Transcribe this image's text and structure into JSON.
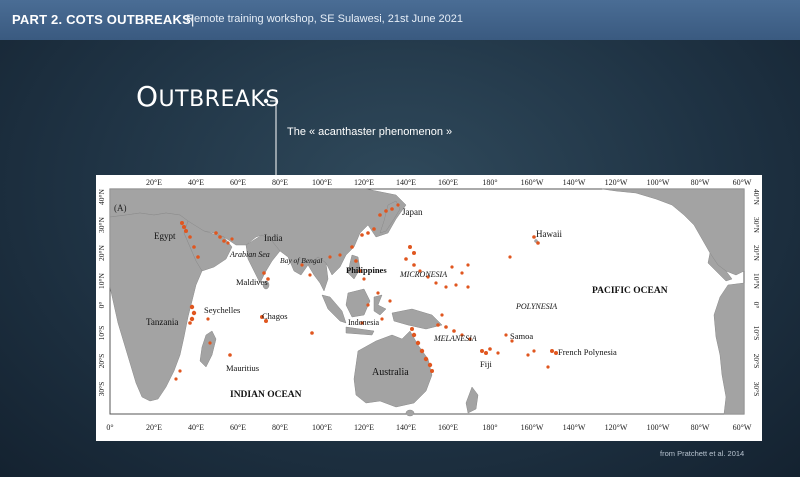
{
  "header": {
    "part_label": "PART 2. COTS OUTBREAKS",
    "separator": "|",
    "subtitle": "Remote training workshop, SE Sulawesi, 21st June 2021"
  },
  "slide": {
    "title_first_letter": "O",
    "title_rest": "UTBREAKS",
    "subtitle": "The « acanthaster phenomenon »",
    "credit": "from Pratchett et al. 2014"
  },
  "map": {
    "panel_label": "(A)",
    "top_longitude_labels": [
      "20°E",
      "40°E",
      "60°E",
      "80°E",
      "100°E",
      "120°E",
      "140°E",
      "160°E",
      "180°",
      "160°W",
      "140°W",
      "120°W",
      "100°W",
      "80°W",
      "60°W"
    ],
    "bottom_longitude_labels": [
      "0°",
      "20°E",
      "40°E",
      "60°E",
      "80°E",
      "100°E",
      "120°E",
      "140°E",
      "160°E",
      "180°",
      "160°W",
      "140°W",
      "120°W",
      "100°W",
      "80°W",
      "60°W"
    ],
    "left_latitude_labels": [
      "40°N",
      "30°N",
      "20°N",
      "10°N",
      "0°",
      "10°S",
      "20°S",
      "30°S"
    ],
    "right_latitude_labels": [
      "40°N",
      "30°N",
      "20°N",
      "10°N",
      "0°",
      "10°S",
      "20°S",
      "30°S"
    ],
    "place_labels": {
      "egypt": "Egypt",
      "india": "India",
      "japan": "Japan",
      "arabian_sea": "Arabian Sea",
      "bay_of_bengal": "Bay of Bengal",
      "hawaii": "Hawaii",
      "maldives": "Maldives",
      "philippines": "Philippines",
      "micronesia": "MICRONESIA",
      "pacific_ocean": "PACIFIC OCEAN",
      "polynesia": "POLYNESIA",
      "seychelles": "Seychelles",
      "tanzania": "Tanzania",
      "chagos": "Chagos",
      "indonesia": "Indonesia",
      "samoa": "Samoa",
      "melanesia": "MELANESIA",
      "fiji": "Fiji",
      "french_polynesia": "French Polynesia",
      "mauritius": "Mauritius",
      "australia": "Australia",
      "indian_ocean": "INDIAN OCEAN"
    },
    "colors": {
      "land": "#a3a3a3",
      "ocean": "#ffffff",
      "outbreak": "#e0561f"
    }
  }
}
